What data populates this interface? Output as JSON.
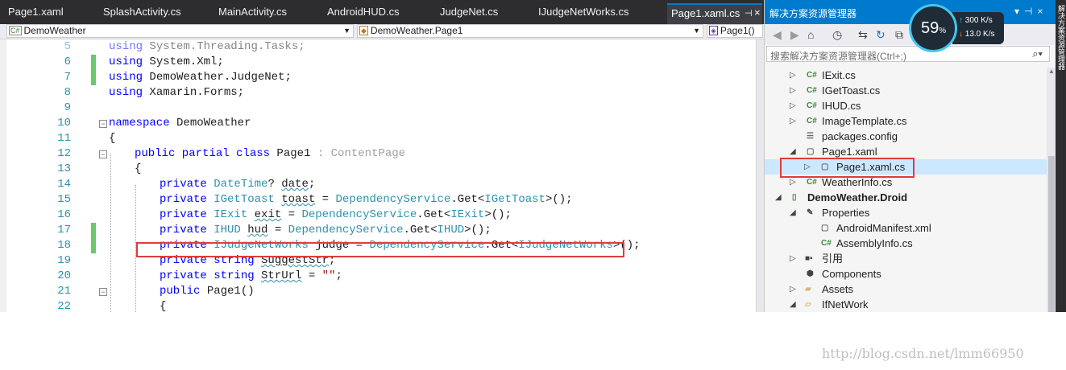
{
  "tabs": [
    "Page1.xaml",
    "SplashActivity.cs",
    "MainActivity.cs",
    "AndroidHUD.cs",
    "JudgeNet.cs",
    "IJudgeNetWorks.cs",
    "Page1.xaml.cs"
  ],
  "nav": {
    "project_combo": "DemoWeather",
    "class_combo": "DemoWeather.Page1",
    "member_combo": "Page1()"
  },
  "code_lines": [
    {
      "n": "5",
      "t": "using System.Threading.Tasks;"
    },
    {
      "n": "6",
      "t": "using System.Xml;"
    },
    {
      "n": "7",
      "t": "using DemoWeather.JudgeNet;"
    },
    {
      "n": "8",
      "t": "using Xamarin.Forms;"
    },
    {
      "n": "9",
      "t": ""
    },
    {
      "n": "10",
      "t": "namespace DemoWeather"
    },
    {
      "n": "11",
      "t": "{"
    },
    {
      "n": "12",
      "t": "public partial class Page1 : ContentPage"
    },
    {
      "n": "13",
      "t": "{"
    },
    {
      "n": "14",
      "t": "private DateTime? date;"
    },
    {
      "n": "15",
      "t": "private IGetToast toast = DependencyService.Get<IGetToast>();"
    },
    {
      "n": "16",
      "t": "private IExit exit = DependencyService.Get<IExit>();"
    },
    {
      "n": "17",
      "t": "private IHUD hud = DependencyService.Get<IHUD>();"
    },
    {
      "n": "18",
      "t": "private IJudgeNetWorks judge = DependencyService.Get<IJudgeNetWorks>();"
    },
    {
      "n": "19",
      "t": "private string SuggestStr;"
    },
    {
      "n": "20",
      "t": "private string StrUrl = \"\";"
    },
    {
      "n": "21",
      "t": "public Page1()"
    },
    {
      "n": "22",
      "t": "{"
    }
  ],
  "solution_explorer": {
    "title": "解决方案资源管理器",
    "search_placeholder": "搜索解决方案资源管理器(Ctrl+;)",
    "items": [
      "IExit.cs",
      "IGetToast.cs",
      "IHUD.cs",
      "ImageTemplate.cs",
      "packages.config",
      "Page1.xaml",
      "Page1.xaml.cs",
      "WeatherInfo.cs",
      "DemoWeather.Droid",
      "Properties",
      "AndroidManifest.xml",
      "AssemblyInfo.cs",
      "引用",
      "Components",
      "Assets",
      "IfNetWork"
    ],
    "cs_badge": "C#",
    "side_text": "解决方案资源管理器"
  },
  "network_monitor": {
    "percent": "59",
    "percent_sign": "%",
    "upload": "300 K/s",
    "download": "13.0 K/s"
  },
  "watermark": "http://blog.csdn.net/lmm66950",
  "colors": {
    "accent": "#007acc",
    "highlight_red": "#e23b3b",
    "keyword_blue": "#0000ff",
    "type_teal": "#2b91af"
  }
}
